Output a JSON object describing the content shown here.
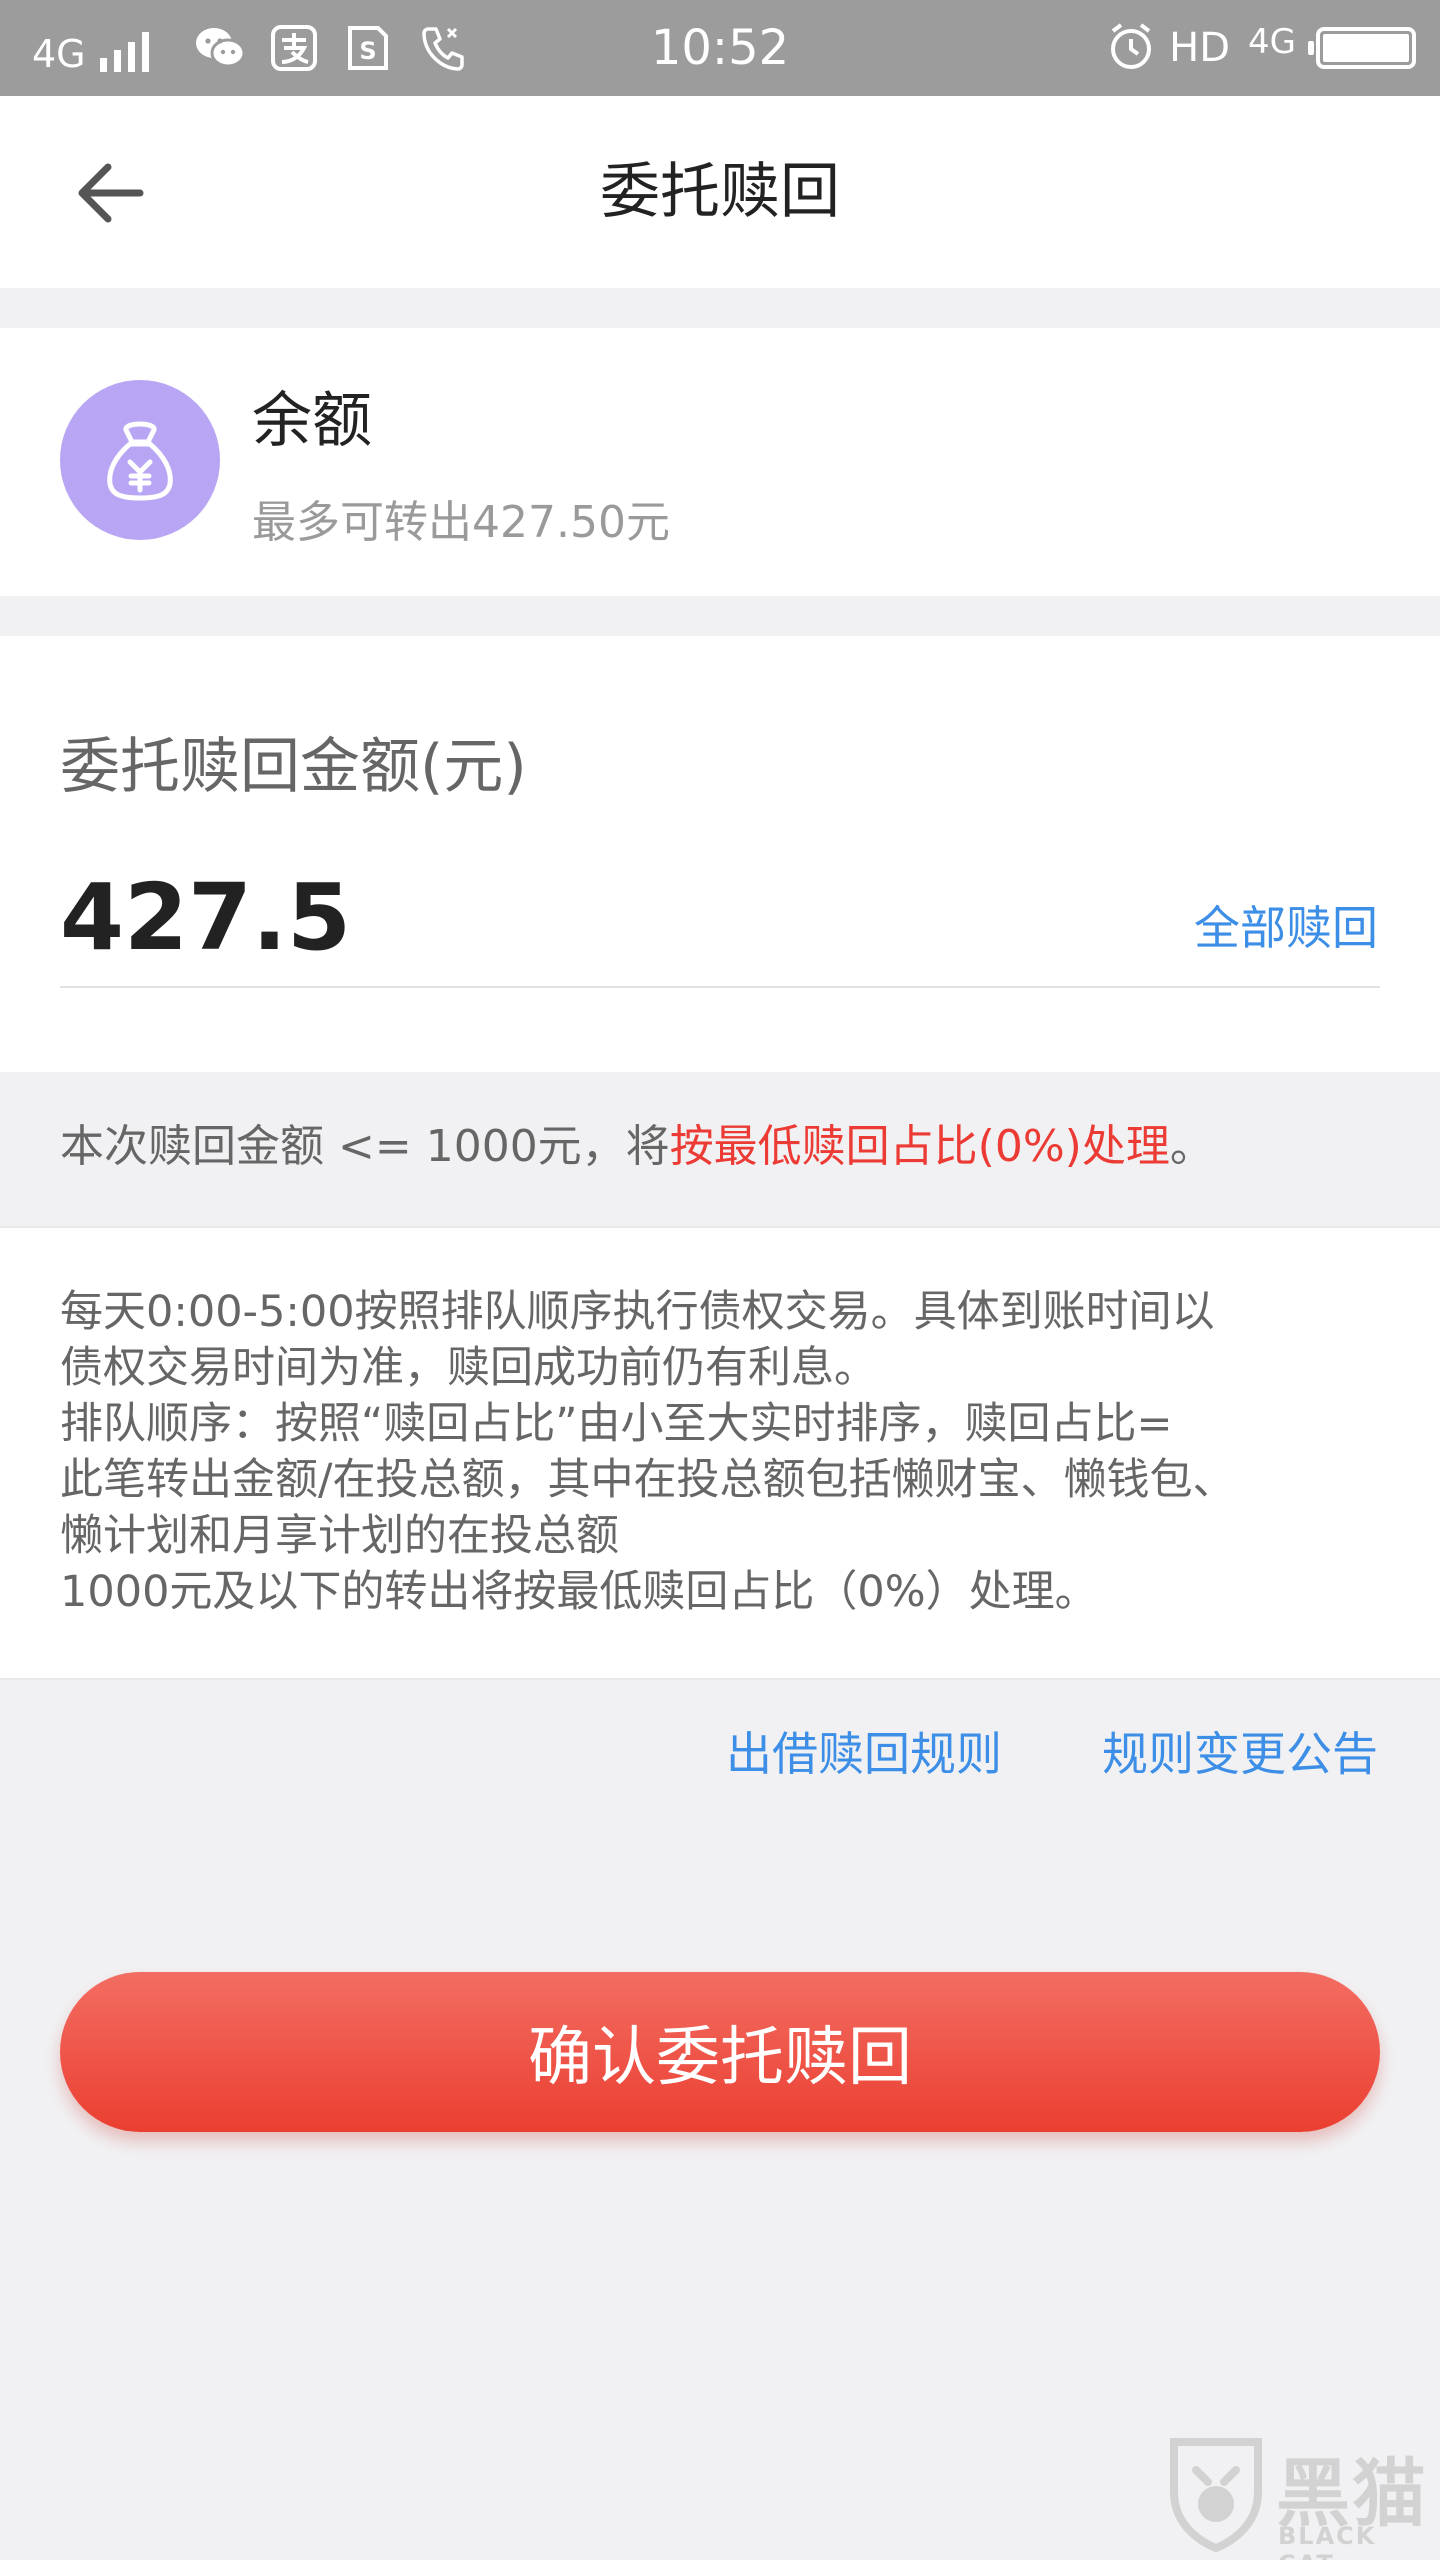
{
  "status_bar": {
    "network": "4G",
    "time": "10:52",
    "hd": "HD",
    "network_right": "4G",
    "icons": [
      "signal-icon",
      "wechat-icon",
      "alipay-icon",
      "sim-icon",
      "phone-icon",
      "alarm-icon",
      "battery-icon"
    ]
  },
  "header": {
    "title": "委托赎回",
    "back_icon": "arrow-left-icon"
  },
  "balance": {
    "icon": "money-bag-icon",
    "title": "余额",
    "subtitle": "最多可转出427.50元"
  },
  "amount": {
    "label": "委托赎回金额(元)",
    "value": "427.5",
    "redeem_all_label": "全部赎回"
  },
  "notice": {
    "prefix": "本次赎回金额 <= 1000元，将",
    "highlight": "按最低赎回占比(0%)处理",
    "suffix": "。"
  },
  "rules": {
    "lines": [
      "每天0:00-5:00按照排队顺序执行债权交易。具体到账时间以",
      "债权交易时间为准，赎回成功前仍有利息。",
      "排队顺序：按照“赎回占比”由小至大实时排序，赎回占比=",
      "此笔转出金额/在投总额，其中在投总额包括懒财宝、懒钱包、",
      "懒计划和月享计划的在投总额",
      "1000元及以下的转出将按最低赎回占比（0%）处理。"
    ]
  },
  "links": {
    "lending_rules": "出借赎回规则",
    "rule_change_notice": "规则变更公告"
  },
  "confirm": {
    "label": "确认委托赎回"
  },
  "watermark": {
    "title": "黑猫",
    "subtitle": "BLACK CAT"
  },
  "colors": {
    "accent_red": "#ec3a34",
    "link_blue": "#3d8ee6",
    "avatar_purple": "#b8a6f5",
    "status_bar_gray": "#9c9c9c"
  }
}
